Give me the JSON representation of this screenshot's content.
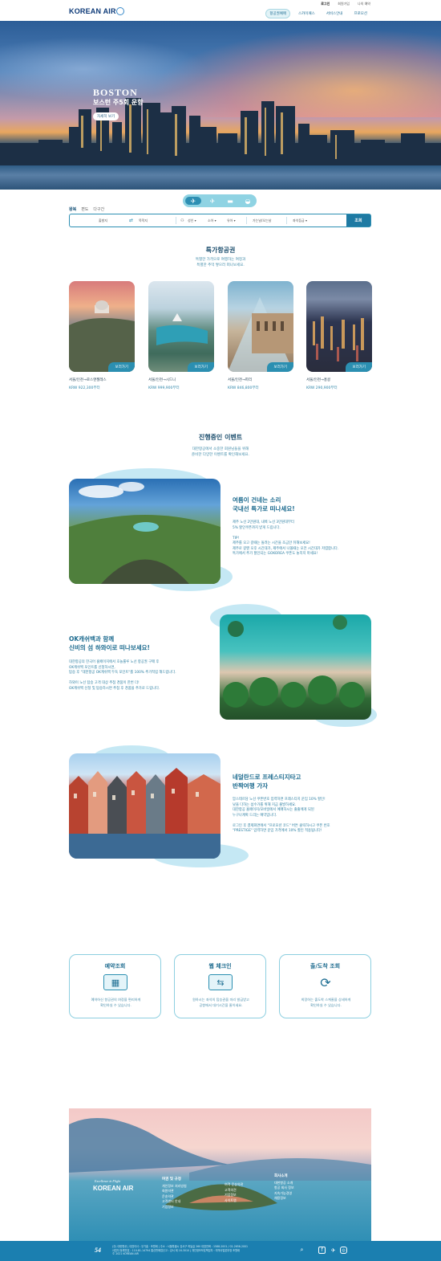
{
  "header": {
    "logo": "KOREAN AIR",
    "top_links": [
      "로그인",
      "회원가입",
      "나의 예약"
    ],
    "nav": [
      "항공권예매",
      "스카이패스",
      "서비스안내",
      "프로모션"
    ]
  },
  "hero": {
    "title": "BOSTON",
    "subtitle": "보스턴 주5회 운항",
    "button": "자세히 보기"
  },
  "search": {
    "trip_tabs": [
      "왕복",
      "편도",
      "다구간"
    ],
    "from": "출발지",
    "to": "목적지",
    "pax1": "성인 ▾",
    "pax2": "소아 ▾",
    "pax3": "유아 ▾",
    "date": "가는날/오는날",
    "cabin": "좌석등급 ▾",
    "submit": "조회"
  },
  "deals": {
    "title": "특가항공권",
    "desc1": "특별한 가격으로 여행하는 여정과",
    "desc2": "특별한 추억 쌓으러 떠나보세요.",
    "more_label": "보러가기",
    "items": [
      {
        "route": "서울/인천→로스앤젤레스",
        "price": "KRW 922,300부터"
      },
      {
        "route": "서울/인천→시드니",
        "price": "KRW 999,900부터"
      },
      {
        "route": "서울/인천→파리",
        "price": "KRW 846,800부터"
      },
      {
        "route": "서울/인천→홍콩",
        "price": "KRW 290,900부터"
      }
    ]
  },
  "events": {
    "title": "진행중인 이벤트",
    "desc1": "대한항공에서 소중한 회원님들을 위해",
    "desc2": "준비한 다양한 이벤트를 확인해보세요.",
    "items": [
      {
        "title1": "여름이 건네는 소리",
        "title2": "국내선 특가로 떠나세요!",
        "lines": [
          "제주 노선 2만원대, 내륙 노선 3만원대부터",
          "5% 할인쿠폰까지 받게 드립니다.",
          "",
          "TIP!",
          "제주를 오고 갈때는 돌려는 시간을 조금만 뒤해보세요!",
          "제주로 갈땐 오후 시간대가, 제주에서 나올때는 오전 시간대가 저렴합니다.",
          "특가에서 추가 할인되는 GOKOREA 쿠폰도 놓치지 마세요!"
        ]
      },
      {
        "title1": "OK캐쉬백과 함께",
        "title2": "신비의 섬 하와이로 떠나보세요!",
        "lines": [
          "대한항공의 한국어 홈페이지에서 호놀룰루 노선 항공권 구매 후",
          "OK캐쉬백 포인트를 신청하시면,",
          "탑승 후 \"대한항공 OK캐쉬백 두둑 포인트\"를 100% 추가적립 해드립니다.",
          "",
          "하와이 노선 탑승 고객 대상 추첨 경품이 한번 더!",
          "OK캐쉬백 신청 및 탑승하시면 추첨 후 경품을 추가로 드립니다."
        ]
      },
      {
        "title1": "네덜란드로 프레스티지타고",
        "title2": "반짝여행 가자",
        "lines": [
          "암스테르담 노선 쿠폰번호 입력하면 프레스티지 운임 10% 할인!",
          "낮을 다하는 섬수가를 위해 지금 출발하세요.",
          "대한항공 홈페이지/모바일에서 예매하시는 출출에게 되된",
          "누구나계획 드리는 예약입니다.",
          "",
          "로그인 후 결제화면에서 \"프로모션 코드\" 버튼 클릭하시고 쿠폰 번호",
          "\"PRESTIGE\" 입력하면 운임 가격에서 10% 할인 적용됩니다!"
        ]
      }
    ]
  },
  "services": [
    {
      "title": "예약조회",
      "desc1": "예약하신 항공권의 여정을 편리하게",
      "desc2": "확인하실 수 있습니다.",
      "icon": "booking-icon"
    },
    {
      "title": "웹 체크인",
      "desc1": "원하시는 좌석의 탑승권을 미리 발급받고",
      "desc2": "공항에서 대기시간을 줄이세요.",
      "icon": "checkin-icon"
    },
    {
      "title": "출/도착 조회",
      "desc1": "희망하는 출도착 스케줄을 상세하게",
      "desc2": "확인하실 수 있습니다.",
      "icon": "arrival-icon"
    }
  ],
  "footer": {
    "tagline": "Excellence in Flight",
    "logo": "KOREAN AIR",
    "cols": [
      {
        "head": "여권 및 규정",
        "items": [
          "개인정보 처리방침",
          "회원약관",
          "운송약관",
          "고객센터 안내",
          "기업정보"
        ]
      },
      {
        "head": "",
        "items": [
          "여객 운송약관",
          "고객의견",
          "기업정보",
          "사이트맵"
        ]
      },
      {
        "head": "회사소개",
        "items": [
          "대한항공 소개",
          "항공 회사 정보",
          "지속가능경영",
          "채용정보"
        ]
      }
    ],
    "address": [
      "(주) 대한항공 | 대표이사 : 우기홍 · 조원태 | 주소 : 서울특별시 강서구 하늘길 260 대표전화 : 1588-2001 / 02-2656-2001",
      "사업자 등록번호 : 110-81-14794 통신판매업신고 : 강서 제 16-3010 | 개인정보보호책임자 : 여객사업본부장 조원태",
      "© 2021 KOREAN AIR"
    ],
    "sign": "54"
  }
}
